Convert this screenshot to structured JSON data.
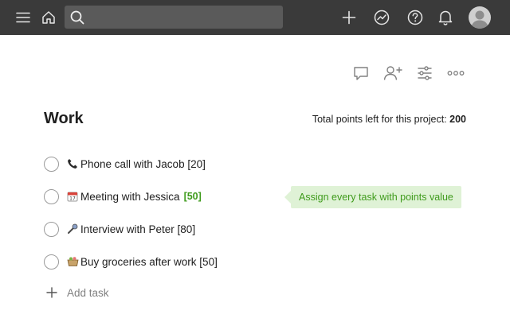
{
  "header": {
    "search": {
      "placeholder": "",
      "value": ""
    },
    "icons": [
      "menu-icon",
      "home-icon",
      "search-icon",
      "add-icon",
      "productivity-icon",
      "help-icon",
      "notifications-icon",
      "avatar"
    ]
  },
  "view_actions": [
    "comment-icon",
    "share-icon",
    "settings-icon",
    "more-icon"
  ],
  "project": {
    "title": "Work",
    "points_label": "Total points left for this project:",
    "points_value": "200"
  },
  "tasks": [
    {
      "icon": "phone-icon",
      "text": "Phone call with Jacob [20]",
      "points_badge": ""
    },
    {
      "icon": "calendar-icon",
      "text": "Meeting with Jessica",
      "points_badge": "[50]"
    },
    {
      "icon": "microphone-icon",
      "text": "Interview with Peter [80]",
      "points_badge": ""
    },
    {
      "icon": "basket-icon",
      "text": "Buy groceries after work [50]",
      "points_badge": ""
    }
  ],
  "tooltip": {
    "text": "Assign every task with points value"
  },
  "add_task": {
    "label": "Add task"
  },
  "colors": {
    "topbar": "#3a3a3a",
    "search_bg": "#5a5a5a",
    "points_green": "#3f9b1c",
    "tooltip_bg": "#dff2d6"
  }
}
